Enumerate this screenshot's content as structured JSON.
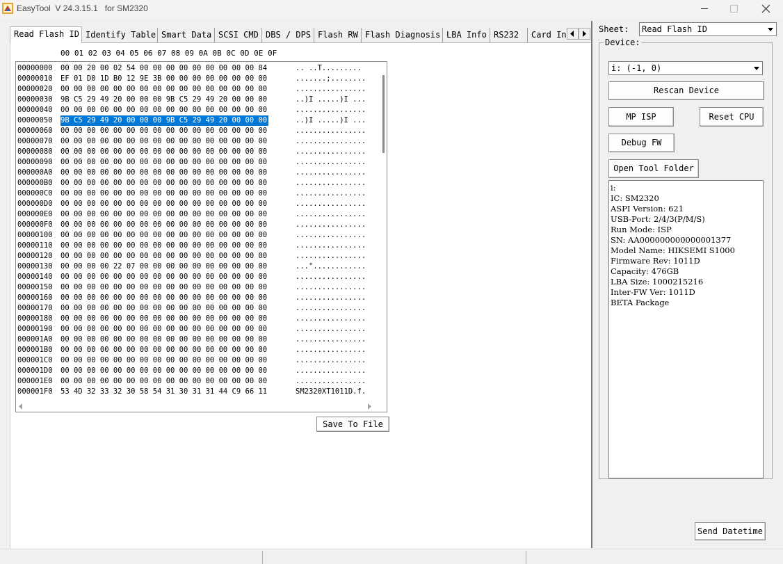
{
  "window": {
    "title": "EasyTool  V 24.3.15.1   for SM2320"
  },
  "tabs": [
    {
      "label": "Read Flash ID",
      "active": true
    },
    {
      "label": "Identify Table"
    },
    {
      "label": "Smart Data"
    },
    {
      "label": "SCSI CMD"
    },
    {
      "label": "DBS / DPS"
    },
    {
      "label": "Flash RW"
    },
    {
      "label": "Flash Diagnosis"
    },
    {
      "label": "LBA Info"
    },
    {
      "label": "RS232"
    },
    {
      "label": "Card In"
    }
  ],
  "hex": {
    "header": "00 01 02 03 04 05 06 07 08 09 0A 0B 0C 0D 0E 0F",
    "selected_row": 5,
    "rows": [
      {
        "off": "00000000",
        "bytes": "00 00 20 00 02 54 00 00 00 00 00 00 00 00 00 84",
        "ascii": ".. ..T........."
      },
      {
        "off": "00000010",
        "bytes": "EF 01 D0 1D B0 12 9E 3B 00 00 00 00 00 00 00 00",
        "ascii": ".......;........"
      },
      {
        "off": "00000020",
        "bytes": "00 00 00 00 00 00 00 00 00 00 00 00 00 00 00 00",
        "ascii": "................"
      },
      {
        "off": "00000030",
        "bytes": "9B C5 29 49 20 00 00 00 9B C5 29 49 20 00 00 00",
        "ascii": "..)I .....)I ..."
      },
      {
        "off": "00000040",
        "bytes": "00 00 00 00 00 00 00 00 00 00 00 00 00 00 00 00",
        "ascii": "................"
      },
      {
        "off": "00000050",
        "bytes": "9B C5 29 49 20 00 00 00 9B C5 29 49 20 00 00 00",
        "ascii": "..)I .....)I ..."
      },
      {
        "off": "00000060",
        "bytes": "00 00 00 00 00 00 00 00 00 00 00 00 00 00 00 00",
        "ascii": "................"
      },
      {
        "off": "00000070",
        "bytes": "00 00 00 00 00 00 00 00 00 00 00 00 00 00 00 00",
        "ascii": "................"
      },
      {
        "off": "00000080",
        "bytes": "00 00 00 00 00 00 00 00 00 00 00 00 00 00 00 00",
        "ascii": "................"
      },
      {
        "off": "00000090",
        "bytes": "00 00 00 00 00 00 00 00 00 00 00 00 00 00 00 00",
        "ascii": "................"
      },
      {
        "off": "000000A0",
        "bytes": "00 00 00 00 00 00 00 00 00 00 00 00 00 00 00 00",
        "ascii": "................"
      },
      {
        "off": "000000B0",
        "bytes": "00 00 00 00 00 00 00 00 00 00 00 00 00 00 00 00",
        "ascii": "................"
      },
      {
        "off": "000000C0",
        "bytes": "00 00 00 00 00 00 00 00 00 00 00 00 00 00 00 00",
        "ascii": "................"
      },
      {
        "off": "000000D0",
        "bytes": "00 00 00 00 00 00 00 00 00 00 00 00 00 00 00 00",
        "ascii": "................"
      },
      {
        "off": "000000E0",
        "bytes": "00 00 00 00 00 00 00 00 00 00 00 00 00 00 00 00",
        "ascii": "................"
      },
      {
        "off": "000000F0",
        "bytes": "00 00 00 00 00 00 00 00 00 00 00 00 00 00 00 00",
        "ascii": "................"
      },
      {
        "off": "00000100",
        "bytes": "00 00 00 00 00 00 00 00 00 00 00 00 00 00 00 00",
        "ascii": "................"
      },
      {
        "off": "00000110",
        "bytes": "00 00 00 00 00 00 00 00 00 00 00 00 00 00 00 00",
        "ascii": "................"
      },
      {
        "off": "00000120",
        "bytes": "00 00 00 00 00 00 00 00 00 00 00 00 00 00 00 00",
        "ascii": "................"
      },
      {
        "off": "00000130",
        "bytes": "00 00 00 00 22 07 00 00 00 00 00 00 00 00 00 00",
        "ascii": "...\"............"
      },
      {
        "off": "00000140",
        "bytes": "00 00 00 00 00 00 00 00 00 00 00 00 00 00 00 00",
        "ascii": "................"
      },
      {
        "off": "00000150",
        "bytes": "00 00 00 00 00 00 00 00 00 00 00 00 00 00 00 00",
        "ascii": "................"
      },
      {
        "off": "00000160",
        "bytes": "00 00 00 00 00 00 00 00 00 00 00 00 00 00 00 00",
        "ascii": "................"
      },
      {
        "off": "00000170",
        "bytes": "00 00 00 00 00 00 00 00 00 00 00 00 00 00 00 00",
        "ascii": "................"
      },
      {
        "off": "00000180",
        "bytes": "00 00 00 00 00 00 00 00 00 00 00 00 00 00 00 00",
        "ascii": "................"
      },
      {
        "off": "00000190",
        "bytes": "00 00 00 00 00 00 00 00 00 00 00 00 00 00 00 00",
        "ascii": "................"
      },
      {
        "off": "000001A0",
        "bytes": "00 00 00 00 00 00 00 00 00 00 00 00 00 00 00 00",
        "ascii": "................"
      },
      {
        "off": "000001B0",
        "bytes": "00 00 00 00 00 00 00 00 00 00 00 00 00 00 00 00",
        "ascii": "................"
      },
      {
        "off": "000001C0",
        "bytes": "00 00 00 00 00 00 00 00 00 00 00 00 00 00 00 00",
        "ascii": "................"
      },
      {
        "off": "000001D0",
        "bytes": "00 00 00 00 00 00 00 00 00 00 00 00 00 00 00 00",
        "ascii": "................"
      },
      {
        "off": "000001E0",
        "bytes": "00 00 00 00 00 00 00 00 00 00 00 00 00 00 00 00",
        "ascii": "................"
      },
      {
        "off": "000001F0",
        "bytes": "53 4D 32 33 32 30 58 54 31 30 31 31 44 C9 66 11",
        "ascii": "SM2320XT1011D.f."
      }
    ]
  },
  "buttons": {
    "save_to_file": "Save To File",
    "rescan_device": "Rescan Device",
    "mp_isp": "MP ISP",
    "reset_cpu": "Reset CPU",
    "debug_fw": "Debug FW",
    "open_tool_folder": "Open Tool Folder",
    "send_datetime": "Send Datetime"
  },
  "sheet": {
    "label": "Sheet:",
    "value": "Read Flash ID"
  },
  "device": {
    "label": "Device:",
    "value": "i: (-1, 0)"
  },
  "info_lines": [
    "i:",
    "IC: SM2320",
    "ASPI Version: 621",
    "USB-Port: 2/4/3(P/M/S)",
    "Run Mode: ISP",
    "SN: AA000000000000001377",
    "Model Name: HIKSEMI S1000",
    "Firmware Rev: 1011D",
    "Capacity: 476GB",
    "LBA Size: 1000215216",
    "Inter-FW Ver: 1011D",
    "BETA Package"
  ],
  "icons": {
    "app": "app-icon",
    "minimize": "minimize-icon",
    "maximize": "maximize-icon",
    "close": "close-icon"
  }
}
